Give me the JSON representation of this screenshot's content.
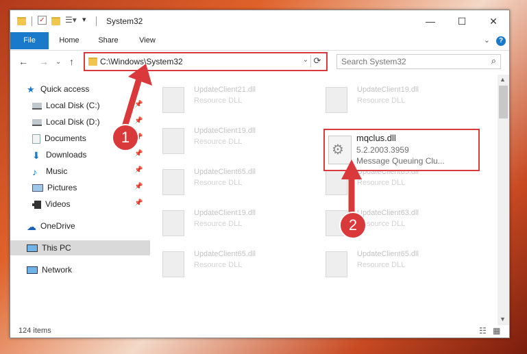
{
  "window": {
    "title": "System32",
    "minimize": "—",
    "maximize": "☐",
    "close": "✕"
  },
  "ribbon": {
    "tabs": [
      "File",
      "Home",
      "Share",
      "View"
    ],
    "help": "?"
  },
  "address_bar": {
    "path": "C:\\Windows\\System32",
    "search_placeholder": "Search System32"
  },
  "sidebar": {
    "items": [
      {
        "label": "Quick access",
        "icon": "star-icon"
      },
      {
        "label": "Local Disk (C:)",
        "icon": "drive-icon",
        "pinned": true
      },
      {
        "label": "Local Disk (D:)",
        "icon": "drive-icon",
        "pinned": true
      },
      {
        "label": "Documents",
        "icon": "documents-icon",
        "pinned": true
      },
      {
        "label": "Downloads",
        "icon": "download-icon",
        "pinned": true
      },
      {
        "label": "Music",
        "icon": "music-icon",
        "pinned": true
      },
      {
        "label": "Pictures",
        "icon": "pictures-icon",
        "pinned": true
      },
      {
        "label": "Videos",
        "icon": "videos-icon",
        "pinned": true
      },
      {
        "label": "OneDrive",
        "icon": "cloud-icon"
      },
      {
        "label": "This PC",
        "icon": "computer-icon",
        "selected": true
      },
      {
        "label": "Network",
        "icon": "network-icon"
      }
    ]
  },
  "files": [
    {
      "name": "UpdateClient21.dll",
      "type": "Resource DLL"
    },
    {
      "name": "UpdateClient19.dll",
      "type": "Resource DLL"
    },
    {
      "name": "UpdateClient19.dll",
      "type": "Resource DLL"
    },
    {
      "name": "UpdateClient65.dll",
      "type": "Resource DLL"
    },
    {
      "name": "UpdateClient65.dll",
      "type": "Resource DLL"
    },
    {
      "name": "UpdateClient19.dll",
      "type": "Resource DLL"
    },
    {
      "name": "UpdateClient63.dll",
      "type": "Resource DLL"
    },
    {
      "name": "UpdateClient65.dll",
      "type": "Resource DLL"
    },
    {
      "name": "UpdateClient65.dll",
      "type": "Resource DLL"
    }
  ],
  "highlighted_file": {
    "name": "mqclus.dll",
    "version": "5.2.2003.3959",
    "description": "Message Queuing Clu..."
  },
  "status": {
    "item_count": "124 items"
  },
  "annotations": {
    "step1": "1",
    "step2": "2",
    "color": "#d9393b"
  }
}
